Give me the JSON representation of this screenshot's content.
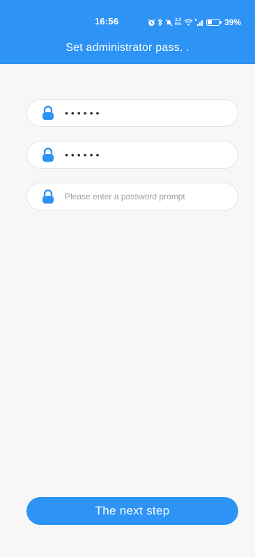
{
  "status_bar": {
    "time": "16:56",
    "network_speed": "2.3\nK/s",
    "battery_percent": "39%"
  },
  "header": {
    "title": "Set administrator pass. ."
  },
  "form": {
    "password": {
      "value": "123456",
      "icon": "lock-icon"
    },
    "confirm_password": {
      "value": "123456",
      "icon": "lock-icon"
    },
    "password_prompt": {
      "value": "",
      "placeholder": "Please enter a password prompt",
      "icon": "lock-icon"
    }
  },
  "actions": {
    "next_label": "The next step"
  },
  "colors": {
    "primary": "#2d93f5",
    "background": "#f7f7f7",
    "field_border": "#dfe3e8"
  }
}
